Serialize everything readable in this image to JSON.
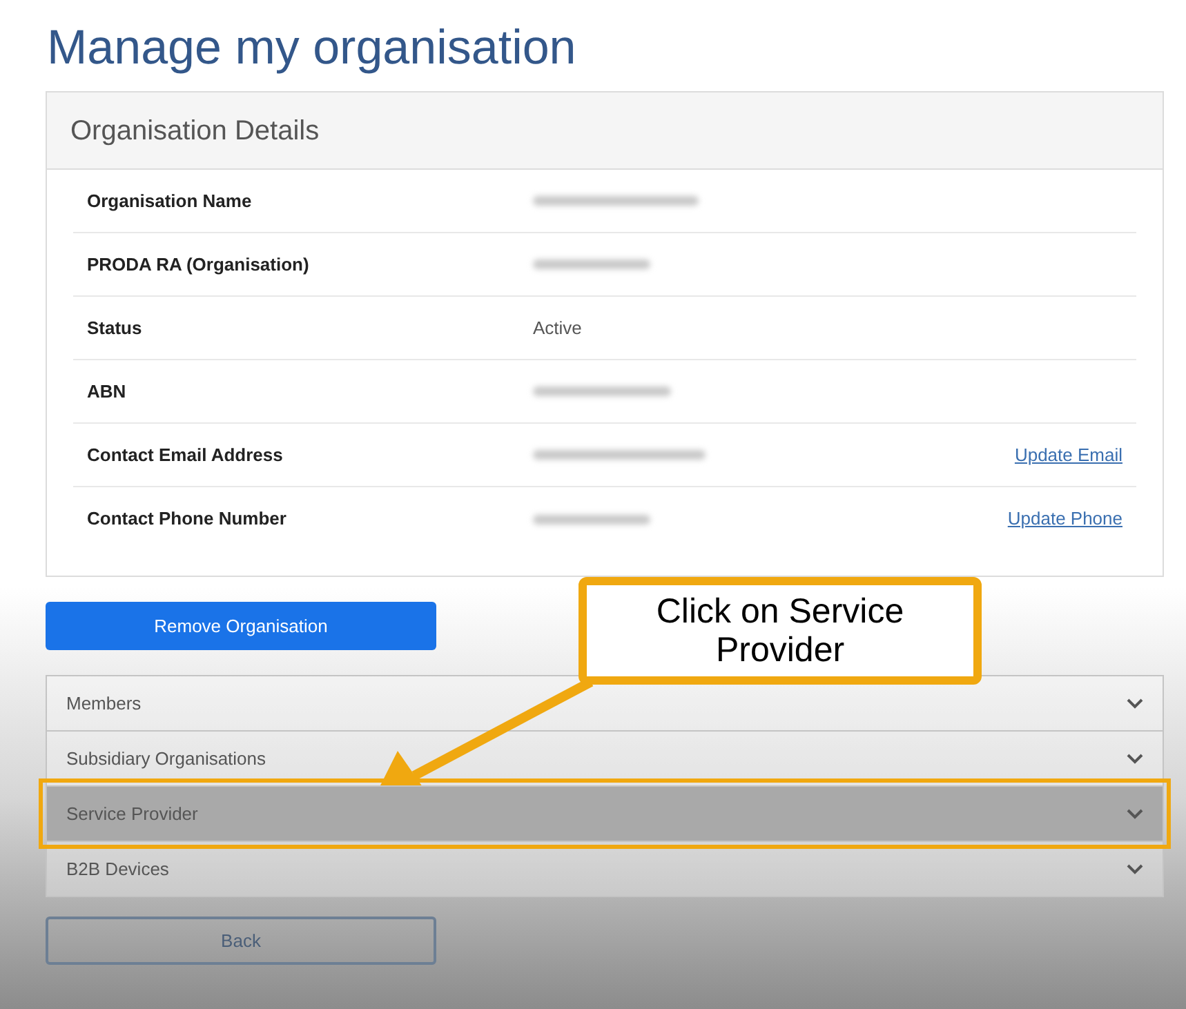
{
  "page_title": "Manage my organisation",
  "details": {
    "title": "Organisation Details",
    "rows": [
      {
        "label": "Organisation Name",
        "kind": "redacted"
      },
      {
        "label": "PRODA RA (Organisation)",
        "kind": "redacted"
      },
      {
        "label": "Status",
        "kind": "text",
        "value": "Active"
      },
      {
        "label": "ABN",
        "kind": "redacted"
      },
      {
        "label": "Contact Email Address",
        "kind": "redacted",
        "action": "Update Email"
      },
      {
        "label": "Contact Phone Number",
        "kind": "redacted",
        "action": "Update Phone"
      }
    ]
  },
  "remove_button": "Remove Organisation",
  "sections": [
    {
      "label": "Members",
      "highlighted": false
    },
    {
      "label": "Subsidiary Organisations",
      "highlighted": false
    },
    {
      "label": "Service Provider",
      "highlighted": true
    },
    {
      "label": "B2B Devices",
      "highlighted": false
    }
  ],
  "back_button": "Back",
  "callout": {
    "text": "Click on Service Provider"
  }
}
